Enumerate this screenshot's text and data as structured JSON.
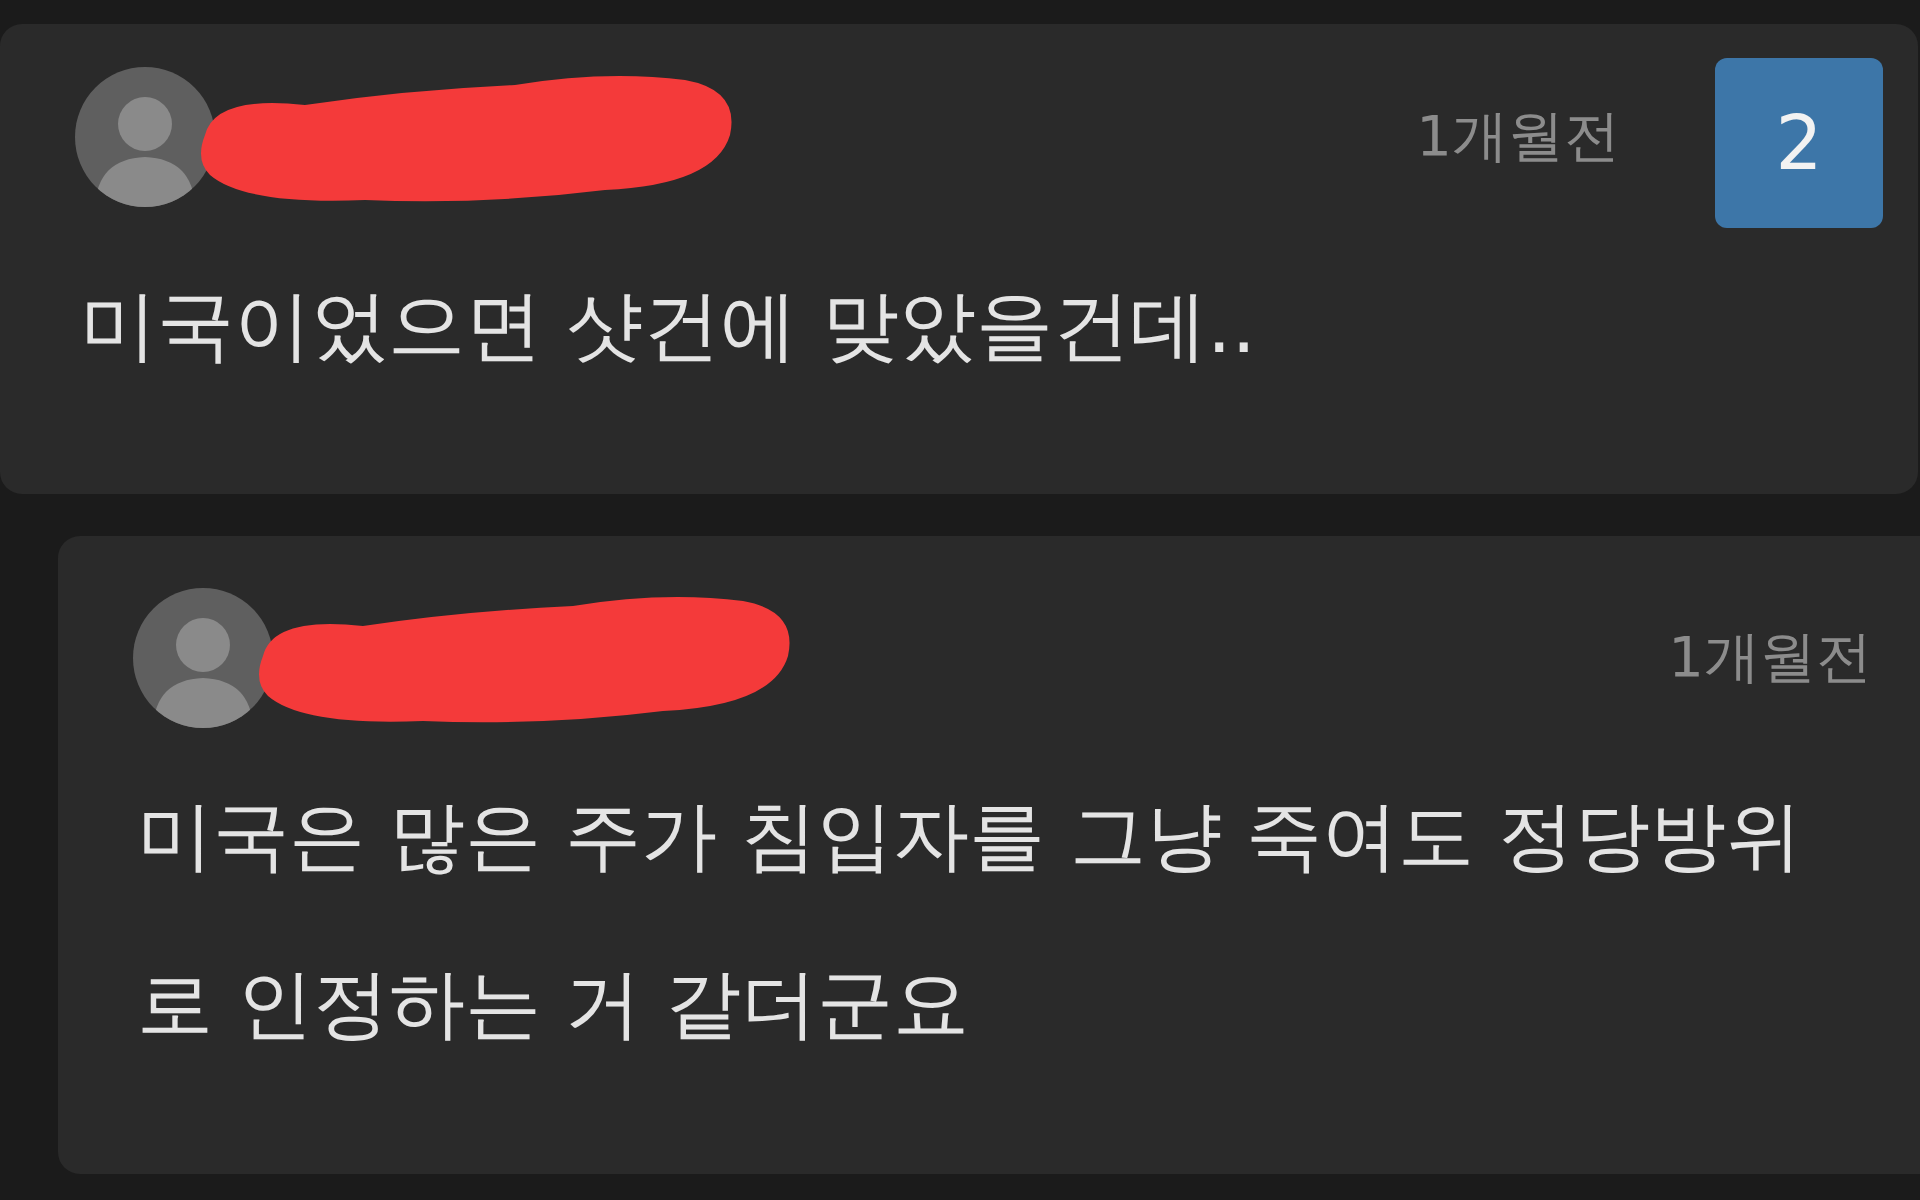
{
  "comments": [
    {
      "kind": "comment",
      "author_redacted": true,
      "time": "1개월전",
      "badge": "2",
      "text": "미국이었으면 샷건에 맞았을건데.."
    },
    {
      "kind": "reply",
      "author_redacted": true,
      "time": "1개월전",
      "text": "미국은 많은 주가 침입자를 그냥 죽여도 정당방위로 인정하는 거 같더군요"
    }
  ]
}
